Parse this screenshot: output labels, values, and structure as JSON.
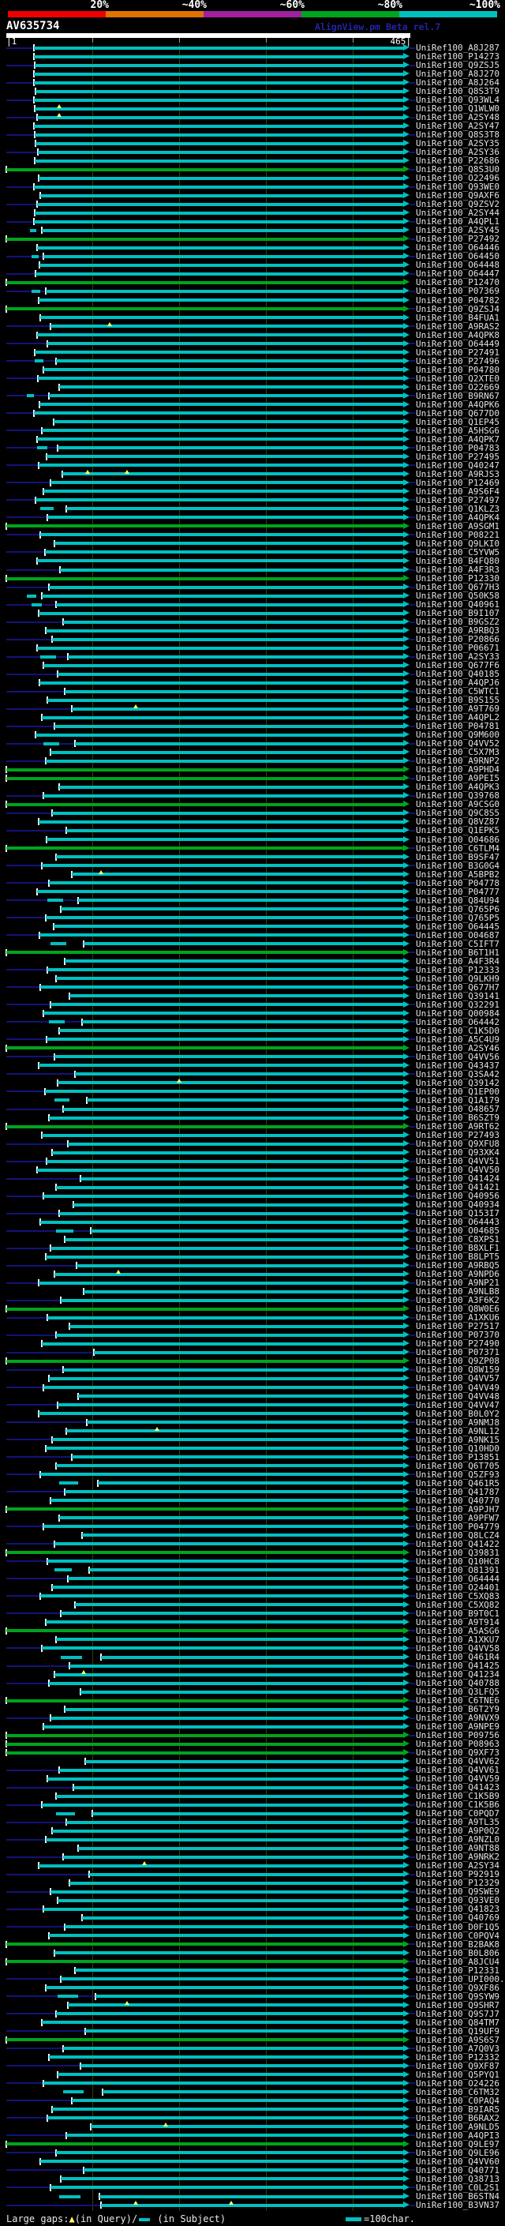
{
  "header": {
    "scale_labels": [
      "20%",
      "~40%",
      "~60%",
      "~80%",
      "~100%"
    ],
    "scale_colors": [
      "#ee0000",
      "#e07300",
      "#a020a0",
      "#00a41e",
      "#00c0c0"
    ],
    "watermark": "AlignView.pm Beta rel.7"
  },
  "query": {
    "name": "AV635734",
    "ruler": {
      "start_label": "|1",
      "end_label": "465|",
      "min": 1,
      "max": 465,
      "ticks": [
        100,
        200,
        300,
        400
      ]
    }
  },
  "footer": {
    "gaps_prefix": "Large gaps:",
    "gap_query_symbol": "▲",
    "gap_query_text": "(in Query)/",
    "gap_subject_text": " (in Subject)",
    "scalebar_text": "=100char."
  },
  "palette": {
    "background": "#000000",
    "hit_high": "#00c0c0",
    "hit_mid": "#00a41e",
    "leader": "#12127a",
    "gridline": "#3c3c00",
    "gap_marker": "#ffff66",
    "query_bar": "#ffffff",
    "label_text": "#e2e2e2"
  },
  "rows": [
    {
      "id": "UniRef100_A8J287",
      "s": 33
    },
    {
      "id": "UniRef100_P14273",
      "s": 33
    },
    {
      "id": "UniRef100_Q9ZSJ5",
      "s": 34
    },
    {
      "id": "UniRef100_A8J270",
      "s": 33
    },
    {
      "id": "UniRef100_A8J264",
      "s": 33
    },
    {
      "id": "UniRef100_Q8S3T9",
      "s": 35
    },
    {
      "id": "UniRef100_Q93WL4",
      "s": 33
    },
    {
      "id": "UniRef100_Q1WLW0",
      "s": 34,
      "g": [
        62
      ]
    },
    {
      "id": "UniRef100_A2SY48",
      "s": 36,
      "g": [
        62
      ]
    },
    {
      "id": "UniRef100_A2SY47",
      "s": 33
    },
    {
      "id": "UniRef100_Q8S3T8",
      "s": 34
    },
    {
      "id": "UniRef100_A2SY35",
      "s": 35
    },
    {
      "id": "UniRef100_A2SY36",
      "s": 37
    },
    {
      "id": "UniRef100_P22686",
      "s": 34
    },
    {
      "id": "UniRef100_Q8S3U0",
      "s": 1,
      "c": "g"
    },
    {
      "id": "UniRef100_O22496",
      "s": 38
    },
    {
      "id": "UniRef100_Q93WE0",
      "s": 33
    },
    {
      "id": "UniRef100_Q9AXF6",
      "s": 40
    },
    {
      "id": "UniRef100_Q9ZSV2",
      "s": 36
    },
    {
      "id": "UniRef100_A2SY44",
      "s": 34
    },
    {
      "id": "UniRef100_A4QPL1",
      "s": 33
    },
    {
      "id": "UniRef100_A2SY45",
      "s": 42,
      "p": [
        28,
        36
      ]
    },
    {
      "id": "UniRef100_P27492",
      "s": 1,
      "c": "g"
    },
    {
      "id": "UniRef100_O64446",
      "s": 36
    },
    {
      "id": "UniRef100_O64450",
      "s": 44,
      "p": [
        30,
        38
      ]
    },
    {
      "id": "UniRef100_O64448",
      "s": 39
    },
    {
      "id": "UniRef100_O64447",
      "s": 35
    },
    {
      "id": "UniRef100_P12470",
      "s": 1,
      "c": "g"
    },
    {
      "id": "UniRef100_P07369",
      "s": 46,
      "p": [
        30,
        40
      ]
    },
    {
      "id": "UniRef100_P04782",
      "s": 38
    },
    {
      "id": "UniRef100_Q9ZSJ4",
      "s": 1,
      "c": "g"
    },
    {
      "id": "UniRef100_B4FUA1",
      "s": 40
    },
    {
      "id": "UniRef100_A9RAS2",
      "s": 52,
      "g": [
        120
      ]
    },
    {
      "id": "UniRef100_A4QPK8",
      "s": 36
    },
    {
      "id": "UniRef100_O64449",
      "s": 48
    },
    {
      "id": "UniRef100_P27491",
      "s": 34
    },
    {
      "id": "UniRef100_P27496",
      "s": 58,
      "p": [
        34,
        44
      ]
    },
    {
      "id": "UniRef100_P04780",
      "s": 44
    },
    {
      "id": "UniRef100_Q2XTE0",
      "s": 37
    },
    {
      "id": "UniRef100_O22669",
      "s": 62
    },
    {
      "id": "UniRef100_B9RN67",
      "s": 50,
      "p": [
        25,
        33
      ]
    },
    {
      "id": "UniRef100_A4QPK6",
      "s": 39
    },
    {
      "id": "UniRef100_Q677D0",
      "s": 33
    },
    {
      "id": "UniRef100_Q1EP45",
      "s": 55
    },
    {
      "id": "UniRef100_A5HSG6",
      "s": 42
    },
    {
      "id": "UniRef100_A4QPK7",
      "s": 36
    },
    {
      "id": "UniRef100_P04783",
      "s": 60,
      "p": [
        36,
        48
      ]
    },
    {
      "id": "UniRef100_P27495",
      "s": 47
    },
    {
      "id": "UniRef100_Q40247",
      "s": 38
    },
    {
      "id": "UniRef100_A9RJS3",
      "s": 65,
      "g": [
        95,
        140
      ]
    },
    {
      "id": "UniRef100_P12469",
      "s": 52
    },
    {
      "id": "UniRef100_A9S6F4",
      "s": 44
    },
    {
      "id": "UniRef100_P27497",
      "s": 35
    },
    {
      "id": "UniRef100_Q1KLZ3",
      "s": 70,
      "p": [
        40,
        55
      ]
    },
    {
      "id": "UniRef100_A4QPK4",
      "s": 48
    },
    {
      "id": "UniRef100_A9SGM1",
      "s": 1,
      "c": "g"
    },
    {
      "id": "UniRef100_P08221",
      "s": 40
    },
    {
      "id": "UniRef100_Q9LKI0",
      "s": 56
    },
    {
      "id": "UniRef100_C5YVW5",
      "s": 45
    },
    {
      "id": "UniRef100_B4FQ80",
      "s": 36
    },
    {
      "id": "UniRef100_A4F3R3",
      "s": 63
    },
    {
      "id": "UniRef100_P12330",
      "s": 1,
      "c": "g"
    },
    {
      "id": "UniRef100_Q677H3",
      "s": 50
    },
    {
      "id": "UniRef100_Q50K58",
      "s": 42,
      "p": [
        25,
        36
      ]
    },
    {
      "id": "UniRef100_Q40961",
      "s": 58,
      "p": [
        30,
        42
      ]
    },
    {
      "id": "UniRef100_B9I107",
      "s": 38
    },
    {
      "id": "UniRef100_B9GSZ2",
      "s": 66
    },
    {
      "id": "UniRef100_A9RBQ3",
      "s": 46
    },
    {
      "id": "UniRef100_P20866",
      "s": 54
    },
    {
      "id": "UniRef100_P06671",
      "s": 36
    },
    {
      "id": "UniRef100_A2SY33",
      "s": 72,
      "p": [
        40,
        58
      ]
    },
    {
      "id": "UniRef100_Q677F6",
      "s": 44
    },
    {
      "id": "UniRef100_Q40185",
      "s": 60
    },
    {
      "id": "UniRef100_A4QPJ6",
      "s": 39
    },
    {
      "id": "UniRef100_C5WTC1",
      "s": 68
    },
    {
      "id": "UniRef100_B9S155",
      "s": 48
    },
    {
      "id": "UniRef100_A9T769",
      "s": 76,
      "g": [
        150
      ]
    },
    {
      "id": "UniRef100_A4QPL2",
      "s": 42
    },
    {
      "id": "UniRef100_P04781",
      "s": 56
    },
    {
      "id": "UniRef100_Q9M600",
      "s": 35
    },
    {
      "id": "UniRef100_Q4VV52",
      "s": 80,
      "p": [
        44,
        62
      ]
    },
    {
      "id": "UniRef100_C5X7M3",
      "s": 52
    },
    {
      "id": "UniRef100_A9RNP2",
      "s": 46
    },
    {
      "id": "UniRef100_A9PHD4",
      "s": 1,
      "c": "g"
    },
    {
      "id": "UniRef100_A9PEI5",
      "s": 1,
      "c": "g"
    },
    {
      "id": "UniRef100_A4QPK3",
      "s": 62
    },
    {
      "id": "UniRef100_Q39768",
      "s": 44
    },
    {
      "id": "UniRef100_A9CSG0",
      "s": 1,
      "c": "g"
    },
    {
      "id": "UniRef100_Q9C8S5",
      "s": 54
    },
    {
      "id": "UniRef100_Q8VZ87",
      "s": 38
    },
    {
      "id": "UniRef100_Q1EPK5",
      "s": 70
    },
    {
      "id": "UniRef100_O04686",
      "s": 47
    },
    {
      "id": "UniRef100_C6TLM4",
      "s": 1,
      "c": "g"
    },
    {
      "id": "UniRef100_B9SF47",
      "s": 58
    },
    {
      "id": "UniRef100_B3G0G4",
      "s": 42
    },
    {
      "id": "UniRef100_A5BPB2",
      "s": 76,
      "g": [
        110
      ]
    },
    {
      "id": "UniRef100_P04778",
      "s": 50
    },
    {
      "id": "UniRef100_P04777",
      "s": 36
    },
    {
      "id": "UniRef100_Q84U94",
      "s": 84,
      "p": [
        48,
        66
      ]
    },
    {
      "id": "UniRef100_Q765P6",
      "s": 64
    },
    {
      "id": "UniRef100_Q765P5",
      "s": 46
    },
    {
      "id": "UniRef100_O64445",
      "s": 55
    },
    {
      "id": "UniRef100_O04687",
      "s": 39
    },
    {
      "id": "UniRef100_C5IFT7",
      "s": 90,
      "p": [
        52,
        70
      ]
    },
    {
      "id": "UniRef100_B6T1H1",
      "s": 1,
      "c": "g"
    },
    {
      "id": "UniRef100_A4F3R4",
      "s": 68
    },
    {
      "id": "UniRef100_P12333",
      "s": 48
    },
    {
      "id": "UniRef100_Q9LKH9",
      "s": 58
    },
    {
      "id": "UniRef100_Q677H7",
      "s": 40
    },
    {
      "id": "UniRef100_Q39141",
      "s": 74
    },
    {
      "id": "UniRef100_Q32291",
      "s": 52
    },
    {
      "id": "UniRef100_Q00984",
      "s": 44
    },
    {
      "id": "UniRef100_O64442",
      "s": 88,
      "p": [
        50,
        68
      ]
    },
    {
      "id": "UniRef100_C1K5D0",
      "s": 62
    },
    {
      "id": "UniRef100_A5C4U9",
      "s": 47
    },
    {
      "id": "UniRef100_A2SY46",
      "s": 1,
      "c": "g"
    },
    {
      "id": "UniRef100_Q4VV56",
      "s": 56
    },
    {
      "id": "UniRef100_Q43437",
      "s": 38
    },
    {
      "id": "UniRef100_Q3SA42",
      "s": 80
    },
    {
      "id": "UniRef100_Q39142",
      "s": 60,
      "g": [
        200
      ]
    },
    {
      "id": "UniRef100_Q1EP00",
      "s": 45
    },
    {
      "id": "UniRef100_Q1A179",
      "s": 94,
      "p": [
        56,
        74
      ]
    },
    {
      "id": "UniRef100_O48657",
      "s": 66
    },
    {
      "id": "UniRef100_B6SZT9",
      "s": 50
    },
    {
      "id": "UniRef100_A9RT62",
      "s": 1,
      "c": "g"
    },
    {
      "id": "UniRef100_P27493",
      "s": 42
    },
    {
      "id": "UniRef100_Q9XFU8",
      "s": 72
    },
    {
      "id": "UniRef100_Q93XK4",
      "s": 54
    },
    {
      "id": "UniRef100_Q4VV51",
      "s": 47
    },
    {
      "id": "UniRef100_Q4VV50",
      "s": 36
    },
    {
      "id": "UniRef100_Q41424",
      "s": 86
    },
    {
      "id": "UniRef100_Q41421",
      "s": 58
    },
    {
      "id": "UniRef100_Q40956",
      "s": 44
    },
    {
      "id": "UniRef100_Q40934",
      "s": 78
    },
    {
      "id": "UniRef100_Q153I7",
      "s": 62
    },
    {
      "id": "UniRef100_O64443",
      "s": 40
    },
    {
      "id": "UniRef100_O04685",
      "s": 98,
      "p": [
        58,
        78
      ]
    },
    {
      "id": "UniRef100_C8XPS1",
      "s": 68
    },
    {
      "id": "UniRef100_B8XLF1",
      "s": 52
    },
    {
      "id": "UniRef100_B8LPT5",
      "s": 46
    },
    {
      "id": "UniRef100_A9RBQ5",
      "s": 82
    },
    {
      "id": "UniRef100_A9NPD6",
      "s": 56,
      "g": [
        130
      ]
    },
    {
      "id": "UniRef100_A9NP21",
      "s": 38
    },
    {
      "id": "UniRef100_A9NLB8",
      "s": 90
    },
    {
      "id": "UniRef100_A3F6K2",
      "s": 64
    },
    {
      "id": "UniRef100_Q8W0E6",
      "s": 1,
      "c": "g"
    },
    {
      "id": "UniRef100_A1XKU6",
      "s": 48
    },
    {
      "id": "UniRef100_P27517",
      "s": 74
    },
    {
      "id": "UniRef100_P07370",
      "s": 58
    },
    {
      "id": "UniRef100_P27490",
      "s": 42
    },
    {
      "id": "UniRef100_P07371",
      "s": 102
    },
    {
      "id": "UniRef100_Q9ZP08",
      "s": 1,
      "c": "g"
    },
    {
      "id": "UniRef100_Q8W159",
      "s": 66
    },
    {
      "id": "UniRef100_Q4VV57",
      "s": 50
    },
    {
      "id": "UniRef100_Q4VV49",
      "s": 44
    },
    {
      "id": "UniRef100_Q4VV48",
      "s": 84
    },
    {
      "id": "UniRef100_Q4VV47",
      "s": 60
    },
    {
      "id": "UniRef100_B0L0Y2",
      "s": 38
    },
    {
      "id": "UniRef100_A9NMJ8",
      "s": 94
    },
    {
      "id": "UniRef100_A9NL12",
      "s": 70,
      "g": [
        175
      ]
    },
    {
      "id": "UniRef100_A9NK15",
      "s": 54
    },
    {
      "id": "UniRef100_Q10HD0",
      "s": 46
    },
    {
      "id": "UniRef100_P13851",
      "s": 76
    },
    {
      "id": "UniRef100_Q6T705",
      "s": 58
    },
    {
      "id": "UniRef100_Q5ZF93",
      "s": 40
    },
    {
      "id": "UniRef100_Q461R5",
      "s": 106,
      "p": [
        62,
        84
      ]
    },
    {
      "id": "UniRef100_Q41787",
      "s": 68
    },
    {
      "id": "UniRef100_Q40770",
      "s": 52
    },
    {
      "id": "UniRef100_A9PJH7",
      "s": 1,
      "c": "g"
    },
    {
      "id": "UniRef100_A9PFW7",
      "s": 62
    },
    {
      "id": "UniRef100_P04779",
      "s": 44
    },
    {
      "id": "UniRef100_Q8LCZ4",
      "s": 88
    },
    {
      "id": "UniRef100_Q41422",
      "s": 56
    },
    {
      "id": "UniRef100_Q39831",
      "s": 1,
      "c": "g"
    },
    {
      "id": "UniRef100_Q10HC8",
      "s": 48
    },
    {
      "id": "UniRef100_O81391",
      "s": 96,
      "p": [
        56,
        76
      ]
    },
    {
      "id": "UniRef100_O64444",
      "s": 72
    },
    {
      "id": "UniRef100_O24401",
      "s": 54
    },
    {
      "id": "UniRef100_C5XQ83",
      "s": 40
    },
    {
      "id": "UniRef100_C5XQ82",
      "s": 80
    },
    {
      "id": "UniRef100_B9T0C1",
      "s": 64
    },
    {
      "id": "UniRef100_A9T914",
      "s": 46
    },
    {
      "id": "UniRef100_A5ASG6",
      "s": 1,
      "c": "g"
    },
    {
      "id": "UniRef100_A1XKU7",
      "s": 58
    },
    {
      "id": "UniRef100_Q4VV58",
      "s": 42
    },
    {
      "id": "UniRef100_Q461R4",
      "s": 110,
      "p": [
        64,
        88
      ]
    },
    {
      "id": "UniRef100_Q41425",
      "s": 74
    },
    {
      "id": "UniRef100_Q41234",
      "s": 56,
      "g": [
        90
      ]
    },
    {
      "id": "UniRef100_Q40788",
      "s": 50
    },
    {
      "id": "UniRef100_Q3LFQ5",
      "s": 86
    },
    {
      "id": "UniRef100_C6TNE6",
      "s": 1,
      "c": "g"
    },
    {
      "id": "UniRef100_B6T2Y9",
      "s": 68
    },
    {
      "id": "UniRef100_A9NVX9",
      "s": 52
    },
    {
      "id": "UniRef100_A9NPE9",
      "s": 44
    },
    {
      "id": "UniRef100_P09756",
      "s": 1,
      "c": "g"
    },
    {
      "id": "UniRef100_P08963",
      "s": 1,
      "c": "g"
    },
    {
      "id": "UniRef100_Q9XF73",
      "s": 1,
      "c": "g"
    },
    {
      "id": "UniRef100_Q4VV62",
      "s": 92
    },
    {
      "id": "UniRef100_Q4VV61",
      "s": 62
    },
    {
      "id": "UniRef100_Q4VV59",
      "s": 48
    },
    {
      "id": "UniRef100_Q41423",
      "s": 78
    },
    {
      "id": "UniRef100_C1K5B9",
      "s": 58
    },
    {
      "id": "UniRef100_C1K5B6",
      "s": 42
    },
    {
      "id": "UniRef100_C0PQD7",
      "s": 100,
      "p": [
        58,
        80
      ]
    },
    {
      "id": "UniRef100_A9TL35",
      "s": 70
    },
    {
      "id": "UniRef100_A9P0Q2",
      "s": 54
    },
    {
      "id": "UniRef100_A9NZL0",
      "s": 46
    },
    {
      "id": "UniRef100_A9NT88",
      "s": 84
    },
    {
      "id": "UniRef100_A9NRK2",
      "s": 66
    },
    {
      "id": "UniRef100_A2SY34",
      "s": 38,
      "g": [
        160
      ]
    },
    {
      "id": "UniRef100_P92919",
      "s": 96
    },
    {
      "id": "UniRef100_P12329",
      "s": 74
    },
    {
      "id": "UniRef100_Q9SWE9",
      "s": 52
    },
    {
      "id": "UniRef100_Q93VE0",
      "s": 60
    },
    {
      "id": "UniRef100_Q41823",
      "s": 44
    },
    {
      "id": "UniRef100_Q40769",
      "s": 88
    },
    {
      "id": "UniRef100_D0F1Q5",
      "s": 68
    },
    {
      "id": "UniRef100_C0PQV4",
      "s": 50
    },
    {
      "id": "UniRef100_B2BAK8",
      "s": 1,
      "c": "g"
    },
    {
      "id": "UniRef100_B0L806",
      "s": 56
    },
    {
      "id": "UniRef100_A8JCU4",
      "s": 1,
      "c": "g"
    },
    {
      "id": "UniRef100_P12331",
      "s": 80
    },
    {
      "id": "UniRef100_UPI000..",
      "s": 64
    },
    {
      "id": "UniRef100_Q9XF86",
      "s": 46
    },
    {
      "id": "UniRef100_Q9SYW9",
      "s": 104,
      "p": [
        60,
        84
      ]
    },
    {
      "id": "UniRef100_Q9SHR7",
      "s": 72,
      "g": [
        140
      ]
    },
    {
      "id": "UniRef100_Q9S7J7",
      "s": 58
    },
    {
      "id": "UniRef100_Q84TM7",
      "s": 42
    },
    {
      "id": "UniRef100_Q19UF9",
      "s": 92
    },
    {
      "id": "UniRef100_A9S6S7",
      "s": 1,
      "c": "g"
    },
    {
      "id": "UniRef100_A7Q0V3",
      "s": 66
    },
    {
      "id": "UniRef100_P12332",
      "s": 50
    },
    {
      "id": "UniRef100_Q9XF87",
      "s": 86
    },
    {
      "id": "UniRef100_Q5PYQ1",
      "s": 60
    },
    {
      "id": "UniRef100_O24226",
      "s": 44
    },
    {
      "id": "UniRef100_C6TM32",
      "s": 112,
      "p": [
        66,
        90
      ]
    },
    {
      "id": "UniRef100_C0PAQ4",
      "s": 76
    },
    {
      "id": "UniRef100_B9IAR5",
      "s": 54
    },
    {
      "id": "UniRef100_B6RAX2",
      "s": 48
    },
    {
      "id": "UniRef100_A9NLD5",
      "s": 98,
      "g": [
        185
      ]
    },
    {
      "id": "UniRef100_A4QPI3",
      "s": 70
    },
    {
      "id": "UniRef100_Q9LE97",
      "s": 1,
      "c": "g"
    },
    {
      "id": "UniRef100_Q9LE96",
      "s": 58
    },
    {
      "id": "UniRef100_Q4VV60",
      "s": 40
    },
    {
      "id": "UniRef100_Q40771",
      "s": 90
    },
    {
      "id": "UniRef100_Q38713",
      "s": 64
    },
    {
      "id": "UniRef100_C0L2S1",
      "s": 52
    },
    {
      "id": "UniRef100_B6STN4",
      "s": 108,
      "p": [
        62,
        86
      ]
    },
    {
      "id": "UniRef100_B3VN37",
      "s": 110,
      "g": [
        150,
        260
      ]
    }
  ]
}
